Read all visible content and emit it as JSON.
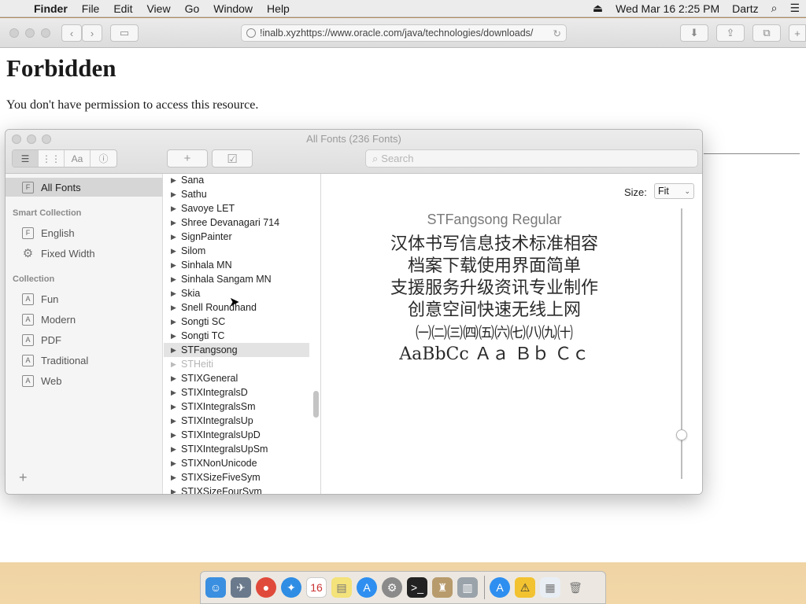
{
  "menubar": {
    "app": "Finder",
    "items": [
      "File",
      "Edit",
      "View",
      "Go",
      "Window",
      "Help"
    ],
    "datetime": "Wed Mar 16  2:25 PM",
    "user": "Dartz"
  },
  "safari": {
    "url": "!inalb.xyzhttps://www.oracle.com/java/technologies/downloads/",
    "heading": "Forbidden",
    "message": "You don't have permission to access this resource."
  },
  "fonts_panel": {
    "title": "All Fonts (236 Fonts)",
    "search_placeholder": "Search",
    "sidebar": {
      "all_fonts": "All Fonts",
      "smart_collection_header": "Smart Collection",
      "smart_collection": [
        "English",
        "Fixed Width"
      ],
      "collection_header": "Collection",
      "collection": [
        "Fun",
        "Modern",
        "PDF",
        "Traditional",
        "Web"
      ]
    },
    "font_list": [
      "Sana",
      "Sathu",
      "Savoye LET",
      "Shree Devanagari 714",
      "SignPainter",
      "Silom",
      "Sinhala MN",
      "Sinhala Sangam MN",
      "Skia",
      "Snell Roundhand",
      "Songti SC",
      "Songti TC",
      "STFangsong",
      "STHeiti",
      "STIXGeneral",
      "STIXIntegralsD",
      "STIXIntegralsSm",
      "STIXIntegralsUp",
      "STIXIntegralsUpD",
      "STIXIntegralsUpSm",
      "STIXNonUnicode",
      "STIXSizeFiveSym",
      "STIXSizeFourSym"
    ],
    "selected_font": "STFangsong",
    "preview": {
      "size_label": "Size:",
      "size_value": "Fit",
      "font_name": "STFangsong Regular",
      "lines": [
        "汉体书写信息技术标准相容",
        "档案下载使用界面简单",
        "支援服务升级资讯专业制作",
        "创意空间快速无线上网",
        "㈠㈡㈢㈣㈤㈥㈦㈧㈨㈩",
        "AaBbCc Ａａ Ｂｂ Ｃｃ"
      ]
    }
  }
}
